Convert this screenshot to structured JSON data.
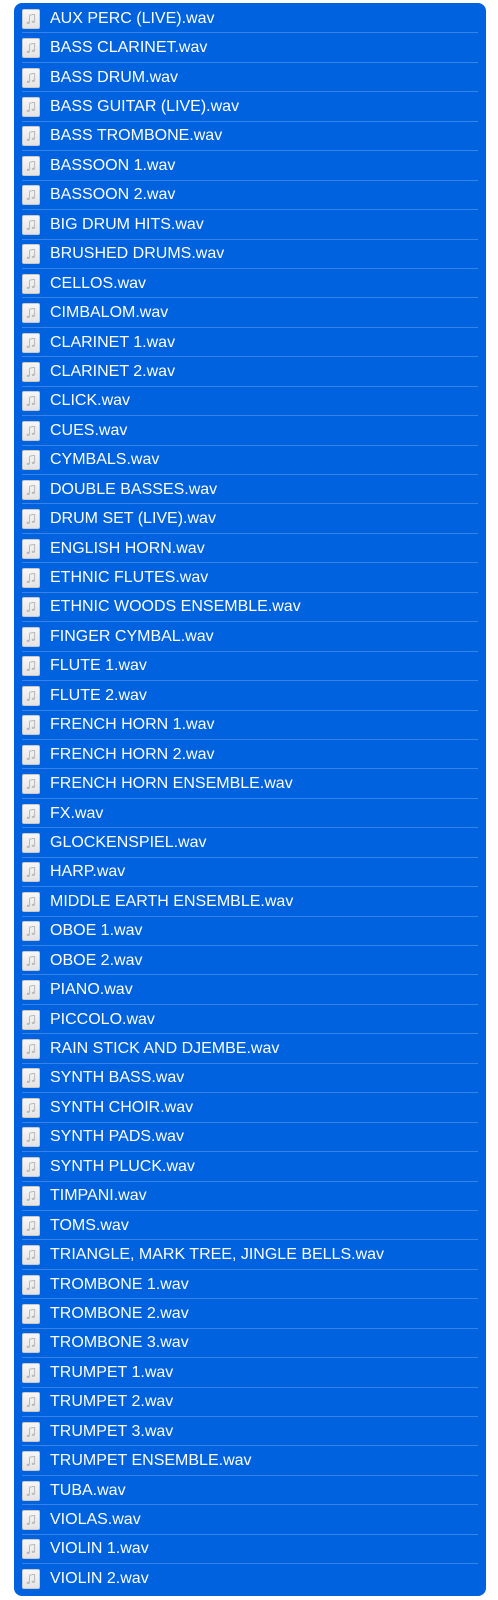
{
  "file_list": {
    "selected": "all",
    "accent_color": "#0062DF",
    "item_icon": "audio-file-icon",
    "items": [
      "AUX PERC (LIVE).wav",
      "BASS CLARINET.wav",
      "BASS DRUM.wav",
      "BASS GUITAR (LIVE).wav",
      "BASS TROMBONE.wav",
      "BASSOON 1.wav",
      "BASSOON 2.wav",
      "BIG DRUM HITS.wav",
      "BRUSHED DRUMS.wav",
      "CELLOS.wav",
      "CIMBALOM.wav",
      "CLARINET 1.wav",
      "CLARINET 2.wav",
      "CLICK.wav",
      "CUES.wav",
      "CYMBALS.wav",
      "DOUBLE BASSES.wav",
      "DRUM SET (LIVE).wav",
      "ENGLISH HORN.wav",
      "ETHNIC FLUTES.wav",
      "ETHNIC WOODS ENSEMBLE.wav",
      "FINGER CYMBAL.wav",
      "FLUTE 1.wav",
      "FLUTE 2.wav",
      "FRENCH HORN 1.wav",
      "FRENCH HORN 2.wav",
      "FRENCH HORN ENSEMBLE.wav",
      "FX.wav",
      "GLOCKENSPIEL.wav",
      "HARP.wav",
      "MIDDLE EARTH ENSEMBLE.wav",
      "OBOE 1.wav",
      "OBOE 2.wav",
      "PIANO.wav",
      "PICCOLO.wav",
      "RAIN STICK AND DJEMBE.wav",
      "SYNTH BASS.wav",
      "SYNTH CHOIR.wav",
      "SYNTH PADS.wav",
      "SYNTH PLUCK.wav",
      "TIMPANI.wav",
      "TOMS.wav",
      "TRIANGLE, MARK TREE, JINGLE BELLS.wav",
      "TROMBONE 1.wav",
      "TROMBONE 2.wav",
      "TROMBONE 3.wav",
      "TRUMPET 1.wav",
      "TRUMPET 2.wav",
      "TRUMPET 3.wav",
      "TRUMPET ENSEMBLE.wav",
      "TUBA.wav",
      "VIOLAS.wav",
      "VIOLIN 1.wav",
      "VIOLIN 2.wav"
    ]
  }
}
